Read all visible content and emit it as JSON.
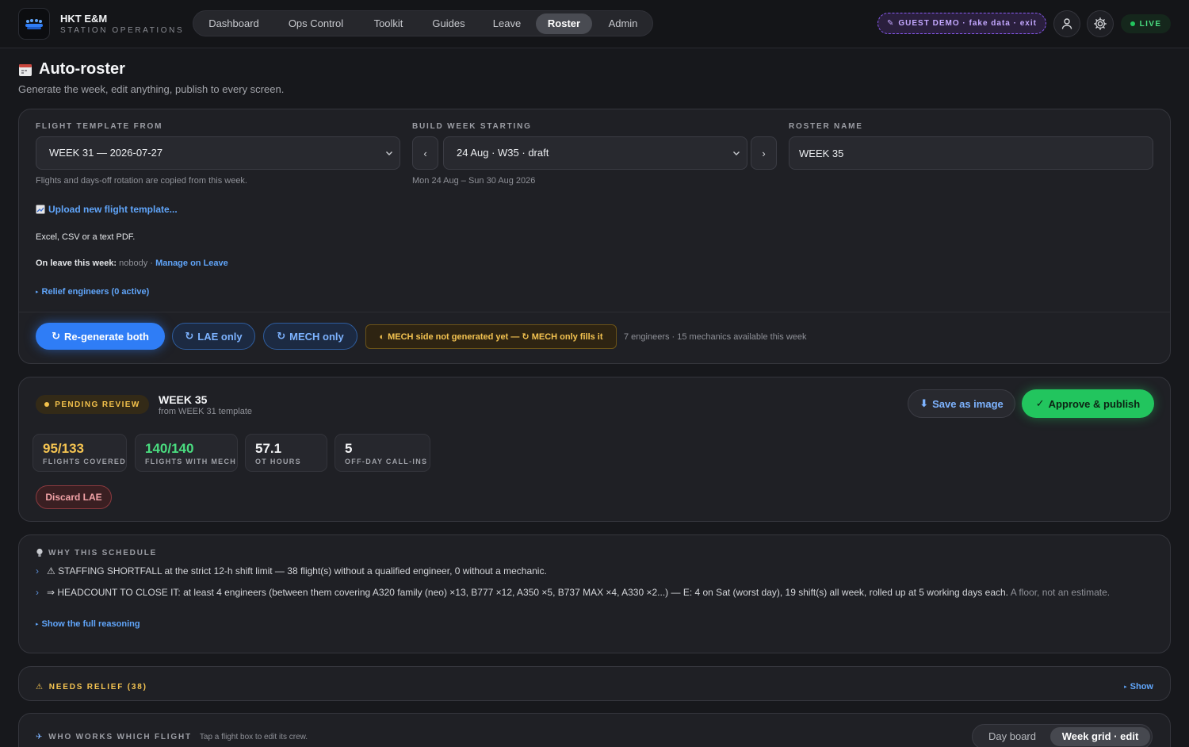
{
  "brand": {
    "name": "HKT E&M",
    "subtitle": "STATION OPERATIONS"
  },
  "nav": [
    "Dashboard",
    "Ops Control",
    "Toolkit",
    "Guides",
    "Leave",
    "Roster",
    "Admin"
  ],
  "nav_active": "Roster",
  "guest_pill": "GUEST DEMO · fake data · exit",
  "live_label": "LIVE",
  "page": {
    "title": "Auto-roster",
    "subtitle": "Generate the week, edit anything, publish to every screen."
  },
  "config": {
    "template_label": "FLIGHT TEMPLATE FROM",
    "template_value": "WEEK 31 — 2026-07-27",
    "template_hint": "Flights and days-off rotation are copied from this week.",
    "build_label": "BUILD WEEK STARTING",
    "build_value": "24 Aug · W35 · draft",
    "build_hint": "Mon 24 Aug – Sun 30 Aug 2026",
    "prev_label": "‹",
    "next_label": "›",
    "roster_label": "ROSTER NAME",
    "roster_value": "WEEK 35",
    "upload_link": "Upload new flight template...",
    "upload_hint": "Excel, CSV or a text PDF.",
    "leave_prefix": "On leave this week:",
    "leave_value": "nobody",
    "leave_sep": "·",
    "leave_link": "Manage on Leave",
    "relief_link": "Relief engineers (0 active)"
  },
  "actions": {
    "regen_both": "Re-generate both",
    "lae_only": "LAE only",
    "mech_only": "MECH only",
    "warning": "MECH side not generated yet — ↻ MECH only fills it",
    "availability": "7 engineers · 15 mechanics available this week"
  },
  "review": {
    "status": "PENDING REVIEW",
    "name": "WEEK 35",
    "source": "from WEEK 31 template",
    "save_label": "Save as image",
    "approve_label": "Approve & publish",
    "discard_label": "Discard LAE",
    "stats": [
      {
        "value": "95/133",
        "label": "FLIGHTS COVERED",
        "color": "#f5c451"
      },
      {
        "value": "140/140",
        "label": "FLIGHTS WITH MECH",
        "color": "#4ade80"
      },
      {
        "value": "57.1",
        "label": "OT HOURS",
        "color": "#f2f3f5"
      },
      {
        "value": "5",
        "label": "OFF-DAY CALL-INS",
        "color": "#f2f3f5"
      }
    ]
  },
  "why": {
    "title": "WHY THIS SCHEDULE",
    "reason1": "⚠ STAFFING SHORTFALL at the strict 12-h shift limit — 38 flight(s) without a qualified engineer, 0 without a mechanic.",
    "reason2": "⇒ HEADCOUNT TO CLOSE IT: at least 4 engineers (between them covering A320 family (neo) ×13, B777 ×12, A350 ×5, B737 MAX ×4, A330 ×2...) — E: 4 on Sat (worst day), 19 shift(s) all week, rolled up at 5 working days each.",
    "reason2_note": "A floor, not an estimate.",
    "show_full": "Show the full reasoning"
  },
  "relief": {
    "title": "NEEDS RELIEF (38)",
    "show": "Show"
  },
  "who": {
    "title": "WHO WORKS WHICH FLIGHT",
    "hint": "Tap a flight box to edit its crew.",
    "views": [
      "Day board",
      "Week grid · edit"
    ]
  }
}
